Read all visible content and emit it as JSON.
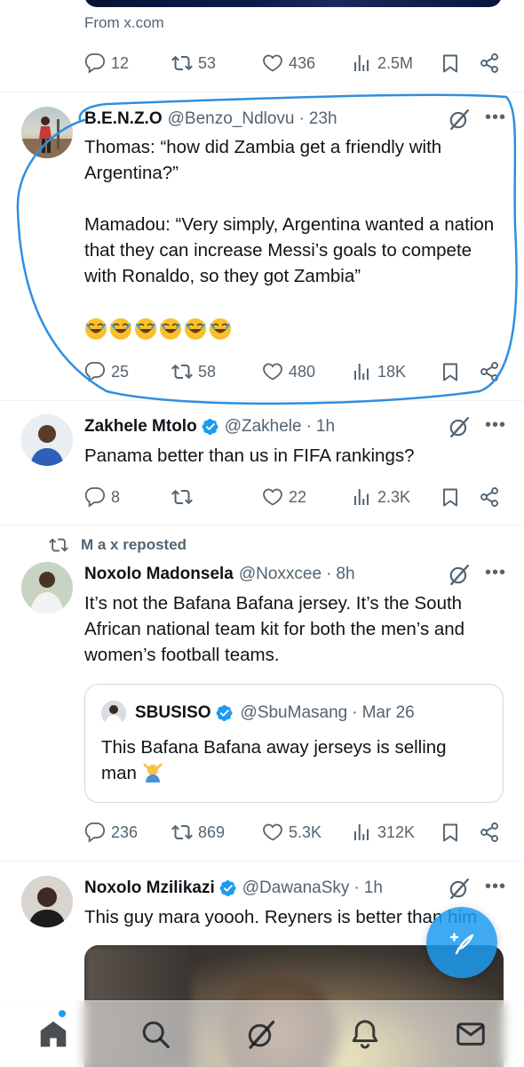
{
  "top": {
    "from_text": "From x.com"
  },
  "tweet0": {
    "actions": {
      "reply": "12",
      "repost": "53",
      "like": "436",
      "views": "2.5M"
    }
  },
  "tweet1": {
    "name": "B.E.N.Z.O",
    "handle": "@Benzo_Ndlovu",
    "sep": "·",
    "time": "23h",
    "text": "Thomas: “how did Zambia get a friendly with Argentina?”\n\nMamadou: “Very simply, Argentina wanted a nation that they can increase Messi’s goals to compete with Ronaldo, so they got Zambia”",
    "emoji_count": 6,
    "actions": {
      "reply": "25",
      "repost": "58",
      "like": "480",
      "views": "18K"
    }
  },
  "tweet2": {
    "name": "Zakhele Mtolo",
    "handle": "@Zakhele",
    "sep": "·",
    "time": "1h",
    "text": "Panama better than us in FIFA rankings?",
    "actions": {
      "reply": "8",
      "repost": "",
      "like": "22",
      "views": "2.3K"
    }
  },
  "tweet3": {
    "repost_label": "M a x reposted",
    "name": "Noxolo Madonsela",
    "handle": "@Noxxcee",
    "sep": "·",
    "time": "8h",
    "text": "It’s not the Bafana Bafana jersey. It’s the South African national team kit for both the men’s and women’s football teams.",
    "quote": {
      "name": "SBUSISO",
      "handle": "@SbuMasang",
      "sep": "·",
      "time": "Mar 26",
      "text": "This Bafana Bafana away jerseys is selling man"
    },
    "actions": {
      "reply": "236",
      "repost": "869",
      "like": "5.3K",
      "views": "312K"
    }
  },
  "tweet4": {
    "name": "Noxolo Mzilikazi",
    "handle": "@DawanaSky",
    "sep": "·",
    "time": "1h",
    "text": "This guy mara yoooh. Reyners is better than him"
  },
  "colors": {
    "accent": "#1d9bf0",
    "secondary_text": "#536471",
    "annotation": "#2f8fe0"
  },
  "icons": [
    "reply-icon",
    "repost-icon",
    "like-icon",
    "views-icon",
    "bookmark-icon",
    "share-icon",
    "grok-icon",
    "more-icon",
    "verified-icon",
    "compose-icon",
    "home-icon",
    "search-icon",
    "notifications-icon",
    "messages-icon"
  ]
}
